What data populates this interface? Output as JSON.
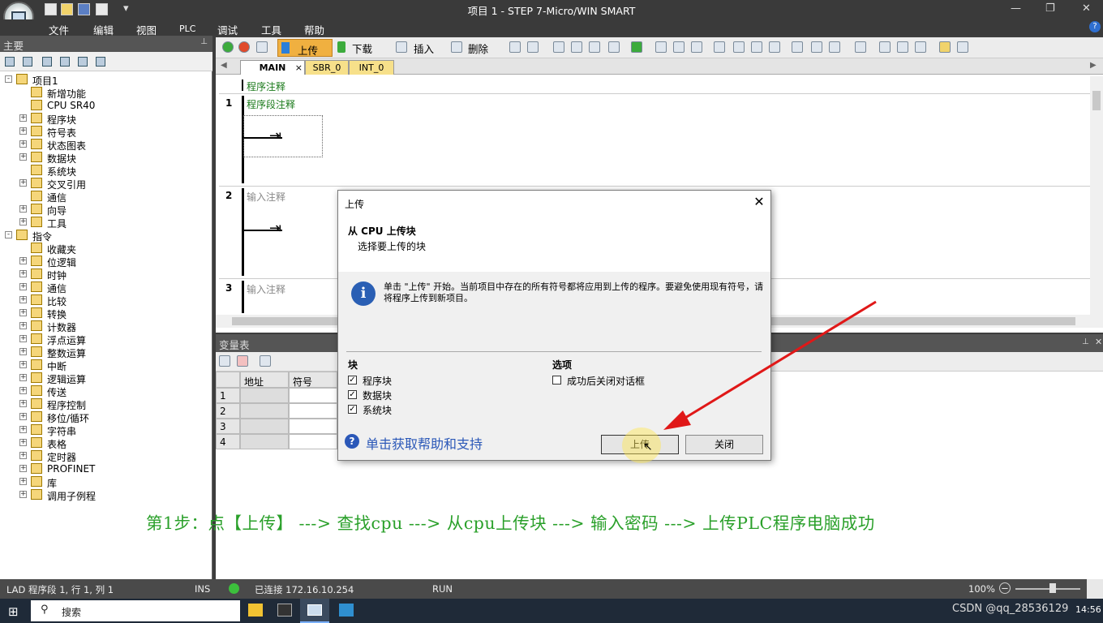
{
  "window": {
    "title": "项目 1 - STEP 7-Micro/WIN SMART"
  },
  "menu": [
    "文件",
    "编辑",
    "视图",
    "PLC",
    "调试",
    "工具",
    "帮助"
  ],
  "left_pane": {
    "header": "主要",
    "tree": [
      {
        "label": "项目1",
        "level": 0,
        "expand": "-"
      },
      {
        "label": "新增功能",
        "level": 1,
        "expand": ""
      },
      {
        "label": "CPU SR40",
        "level": 1,
        "expand": ""
      },
      {
        "label": "程序块",
        "level": 1,
        "expand": "+"
      },
      {
        "label": "符号表",
        "level": 1,
        "expand": "+"
      },
      {
        "label": "状态图表",
        "level": 1,
        "expand": "+"
      },
      {
        "label": "数据块",
        "level": 1,
        "expand": "+"
      },
      {
        "label": "系统块",
        "level": 1,
        "expand": ""
      },
      {
        "label": "交叉引用",
        "level": 1,
        "expand": "+"
      },
      {
        "label": "通信",
        "level": 1,
        "expand": ""
      },
      {
        "label": "向导",
        "level": 1,
        "expand": "+"
      },
      {
        "label": "工具",
        "level": 1,
        "expand": "+"
      },
      {
        "label": "指令",
        "level": 0,
        "expand": "-"
      },
      {
        "label": "收藏夹",
        "level": 1,
        "expand": ""
      },
      {
        "label": "位逻辑",
        "level": 1,
        "expand": "+"
      },
      {
        "label": "时钟",
        "level": 1,
        "expand": "+"
      },
      {
        "label": "通信",
        "level": 1,
        "expand": "+"
      },
      {
        "label": "比较",
        "level": 1,
        "expand": "+"
      },
      {
        "label": "转换",
        "level": 1,
        "expand": "+"
      },
      {
        "label": "计数器",
        "level": 1,
        "expand": "+"
      },
      {
        "label": "浮点运算",
        "level": 1,
        "expand": "+"
      },
      {
        "label": "整数运算",
        "level": 1,
        "expand": "+"
      },
      {
        "label": "中断",
        "level": 1,
        "expand": "+"
      },
      {
        "label": "逻辑运算",
        "level": 1,
        "expand": "+"
      },
      {
        "label": "传送",
        "level": 1,
        "expand": "+"
      },
      {
        "label": "程序控制",
        "level": 1,
        "expand": "+"
      },
      {
        "label": "移位/循环",
        "level": 1,
        "expand": "+"
      },
      {
        "label": "字符串",
        "level": 1,
        "expand": "+"
      },
      {
        "label": "表格",
        "level": 1,
        "expand": "+"
      },
      {
        "label": "定时器",
        "level": 1,
        "expand": "+"
      },
      {
        "label": "PROFINET",
        "level": 1,
        "expand": "+"
      },
      {
        "label": "库",
        "level": 1,
        "expand": "+"
      },
      {
        "label": "调用子例程",
        "level": 1,
        "expand": "+"
      }
    ]
  },
  "toolbar": {
    "upload": "上传",
    "download": "下载",
    "insert": "插入",
    "delete": "删除"
  },
  "editor": {
    "tabs": [
      "MAIN",
      "SBR_0",
      "INT_0"
    ],
    "program_comment": "程序注释",
    "networks": [
      {
        "num": "1",
        "comment": "程序段注释"
      },
      {
        "num": "2",
        "comment": "输入注释"
      },
      {
        "num": "3",
        "comment": "输入注释"
      }
    ]
  },
  "var_table": {
    "title": "变量表",
    "columns": [
      "地址",
      "符号"
    ],
    "rows": [
      "1",
      "2",
      "3",
      "4"
    ]
  },
  "dialog": {
    "title": "上传",
    "heading": "从 CPU 上传块",
    "subheading": "选择要上传的块",
    "info": "单击 \"上传\" 开始。当前项目中存在的所有符号都将应用到上传的程序。要避免使用现有符号，请将程序上传到新项目。",
    "blocks_label": "块",
    "blocks": [
      {
        "label": "程序块",
        "checked": true
      },
      {
        "label": "数据块",
        "checked": true
      },
      {
        "label": "系统块",
        "checked": true
      }
    ],
    "options_label": "选项",
    "option_close": "成功后关闭对话框",
    "help_link": "单击获取帮助和支持",
    "upload_button": "上传",
    "close_button": "关闭"
  },
  "annotation": "第1步：点【上传】 ---> 查找cpu ---> 从cpu上传块 ---> 输入密码 ---> 上传PLC程序电脑成功",
  "status": {
    "position": "LAD 程序段 1, 行 1, 列 1",
    "mode": "INS",
    "connection": "已连接 172.16.10.254",
    "run": "RUN",
    "zoom": "100%"
  },
  "taskbar": {
    "search": "搜索",
    "watermark": "CSDN @qq_28536129",
    "time": "14:56"
  },
  "colors": {
    "annotation": "#2aa02a",
    "accent_upload": "#f0a020",
    "link": "#2b58b8"
  }
}
